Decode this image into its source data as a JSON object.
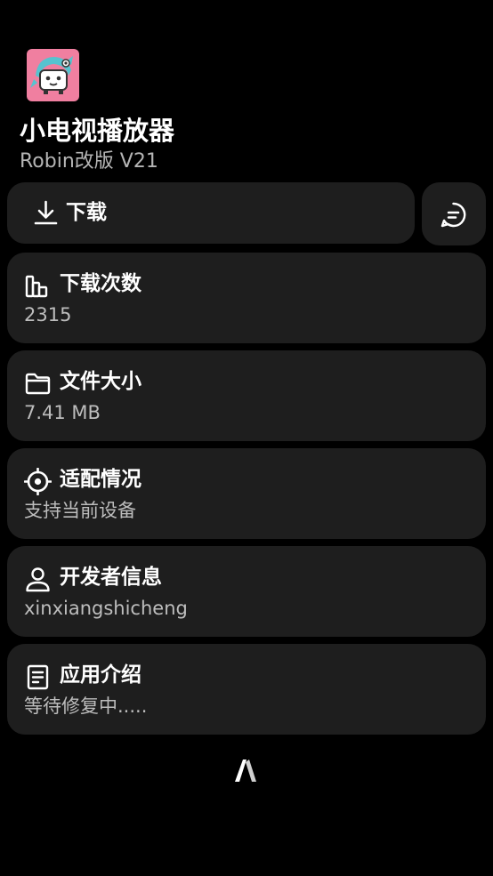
{
  "app": {
    "title": "小电视播放器",
    "subtitle": "Robin改版 V21",
    "icon": "tv-mascot-app-icon"
  },
  "actions": {
    "download_label": "下载",
    "download_icon": "download-icon",
    "comment_icon": "comment-icon"
  },
  "cards": [
    {
      "title": "下载次数",
      "value": "2315",
      "icon": "bar-chart-icon"
    },
    {
      "title": "文件大小",
      "value": "7.41 MB",
      "icon": "folder-icon"
    },
    {
      "title": "适配情况",
      "value": "支持当前设备",
      "icon": "target-icon"
    },
    {
      "title": "开发者信息",
      "value": "xinxiangshicheng",
      "icon": "user-icon"
    },
    {
      "title": "应用介绍",
      "value": "等待修复中.....",
      "icon": "document-icon"
    }
  ],
  "footer": {
    "logo": "store-logo-icon"
  },
  "colors": {
    "background": "#000000",
    "card": "#1e1e1e",
    "icon_pink": "#f07fa0",
    "icon_teal": "#56c3cf",
    "text_primary": "#ffffff",
    "text_secondary": "#bdbdbd"
  }
}
